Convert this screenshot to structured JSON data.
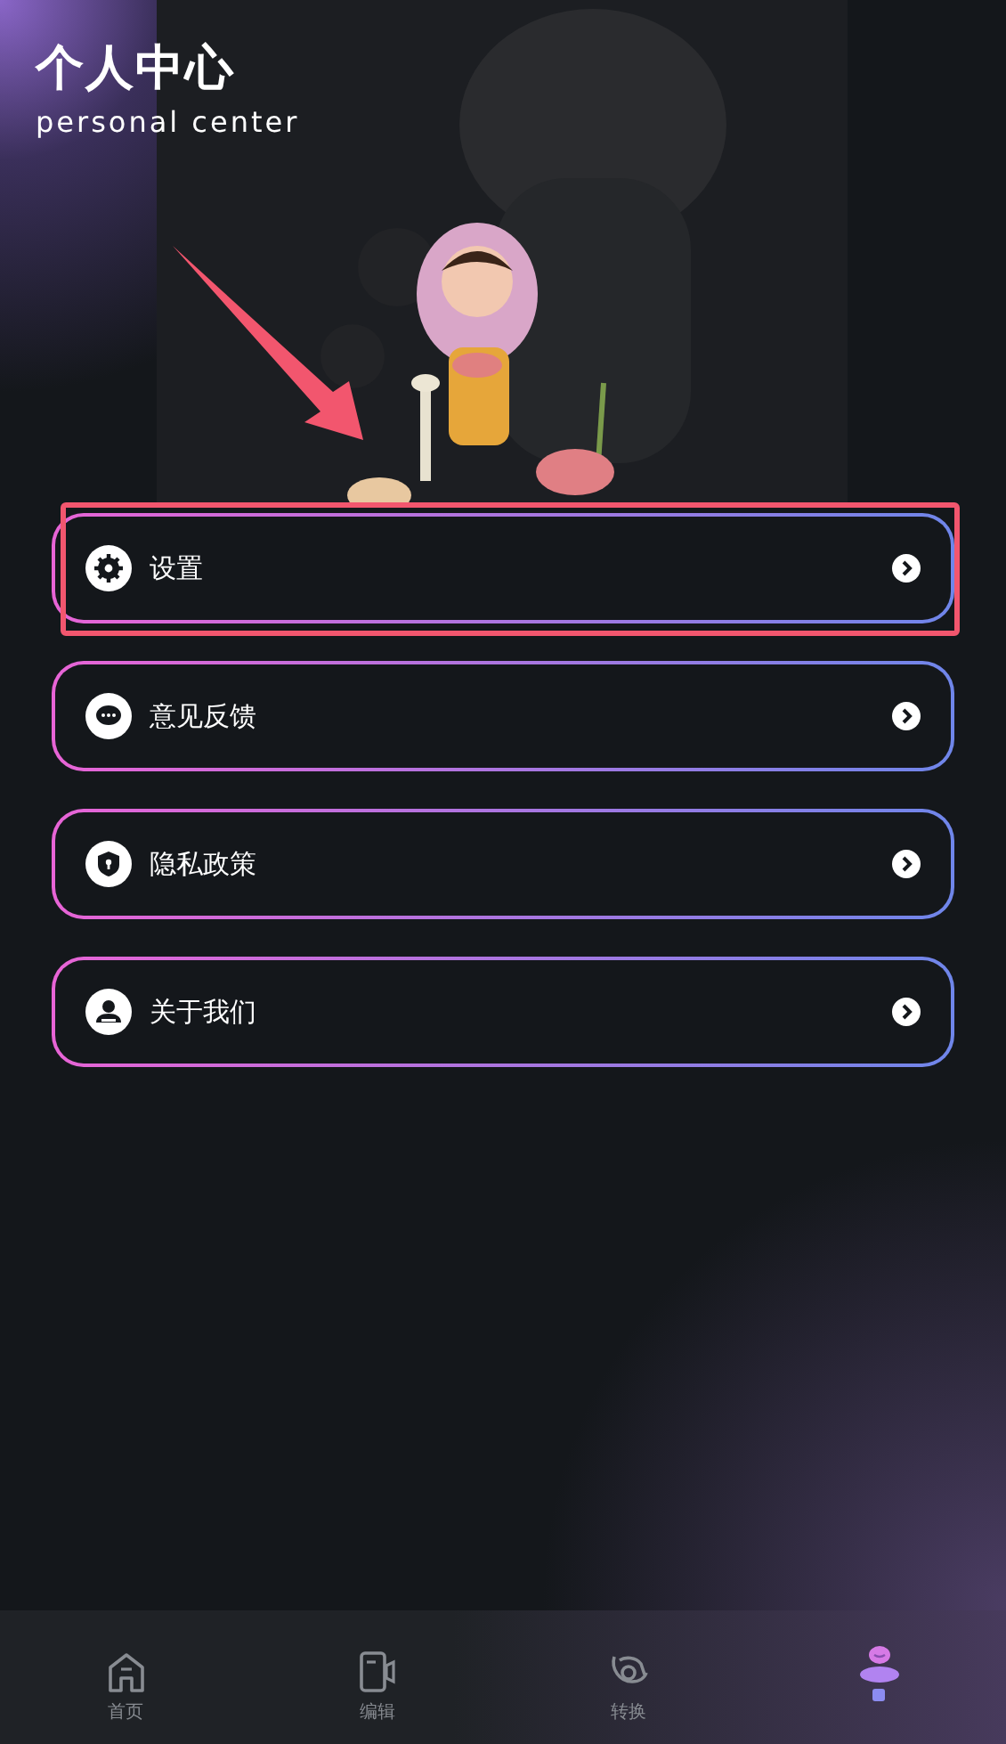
{
  "header": {
    "title": "个人中心",
    "subtitle": "personal center"
  },
  "menu": [
    {
      "kind": "settings",
      "label": "设置",
      "highlighted": true
    },
    {
      "kind": "feedback",
      "label": "意见反馈",
      "highlighted": false
    },
    {
      "kind": "privacy",
      "label": "隐私政策",
      "highlighted": false
    },
    {
      "kind": "about",
      "label": "关于我们",
      "highlighted": false
    }
  ],
  "tabs": [
    {
      "kind": "home",
      "label": "首页",
      "selected": false
    },
    {
      "kind": "edit",
      "label": "编辑",
      "selected": false
    },
    {
      "kind": "convert",
      "label": "转换",
      "selected": false
    },
    {
      "kind": "profile",
      "selected": true
    }
  ]
}
